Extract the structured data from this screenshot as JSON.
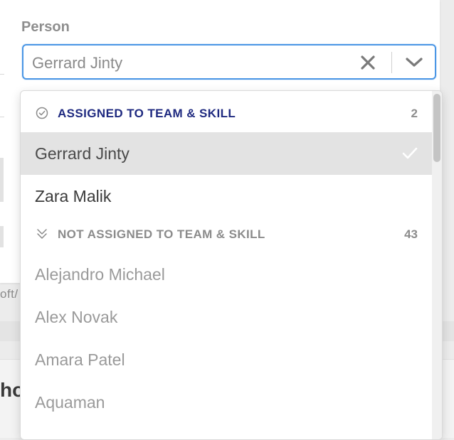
{
  "background": {
    "partial_path_text": "oft/",
    "partial_heading_text": "ho"
  },
  "field": {
    "label": "Person",
    "selected_value": "Gerrard Jinty",
    "clear_icon": "close-icon",
    "dropdown_icon": "chevron-down-icon",
    "accent_color": "#4a96e5"
  },
  "menu": {
    "groups": [
      {
        "title": "ASSIGNED TO TEAM & SKILL",
        "count": "2",
        "icon": "check-circle-icon",
        "color": "#1f2a80",
        "options": [
          {
            "label": "Gerrard Jinty",
            "selected": true
          },
          {
            "label": "Zara Malik",
            "selected": false
          }
        ]
      },
      {
        "title": "NOT ASSIGNED TO TEAM & SKILL",
        "count": "43",
        "icon": "double-chevron-down-icon",
        "color": "#8b8b8b",
        "options": [
          {
            "label": "Alejandro Michael"
          },
          {
            "label": "Alex Novak"
          },
          {
            "label": "Amara Patel"
          },
          {
            "label": "Aquaman"
          }
        ]
      }
    ]
  }
}
